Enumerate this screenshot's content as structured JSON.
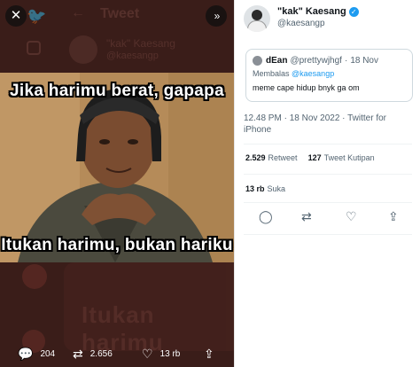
{
  "viewer": {
    "background_header": {
      "title": "Tweet",
      "name": "\"kak\" Kaesang",
      "handle": "@kaesangp"
    },
    "meme": {
      "caption_top": "Jika harimu berat, gapapa",
      "caption_bottom": "Itukan harimu, bukan hariku"
    },
    "background_caption": "Itukan harimu",
    "icons": {
      "close": "close-icon",
      "expand": "expand-icon"
    },
    "actions": {
      "replies": "204",
      "retweets": "2.656",
      "likes": "13 rb"
    }
  },
  "tweet": {
    "author": {
      "name": "\"kak\" Kaesang",
      "handle": "@kaesangp",
      "verified": true
    },
    "quoted": {
      "name": "dEan",
      "handle": "@prettywjhgf",
      "separator": "·",
      "date": "18 Nov",
      "replying_prefix": "Membalas",
      "replying_to": "@kaesangp",
      "text": "meme cape hidup bnyk ga om"
    },
    "timestamp": "12.48 PM · 18 Nov 2022 · Twitter for iPhone",
    "retweets": {
      "count": "2.529",
      "label": "Retweet"
    },
    "quote_tweets": {
      "count": "127",
      "label": "Tweet Kutipan"
    },
    "likes": {
      "count": "13 rb",
      "label": "Suka"
    }
  },
  "colors": {
    "accent": "#1d9bf0",
    "viewer_bg": "#3a1d19",
    "text_secondary": "#536471"
  }
}
